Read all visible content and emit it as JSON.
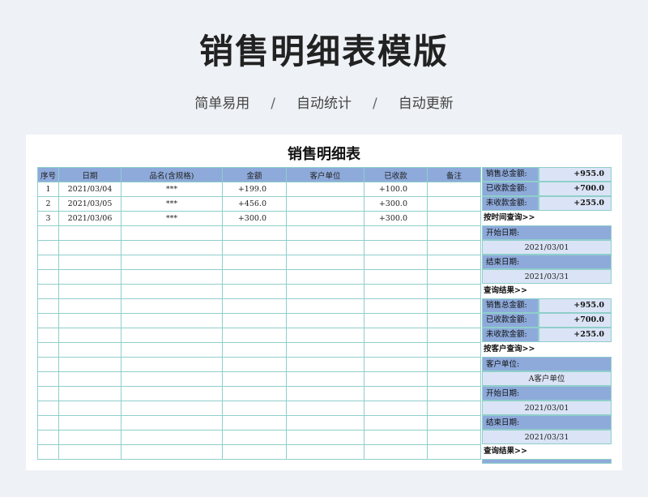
{
  "header": {
    "title": "销售明细表模版",
    "features": [
      "简单易用",
      "自动统计",
      "自动更新"
    ],
    "separator": "/"
  },
  "sheet": {
    "title": "销售明细表",
    "columns": [
      "序号",
      "日期",
      "品名(含规格)",
      "金额",
      "客户单位",
      "已收款",
      "备注"
    ],
    "rows": [
      [
        "1",
        "2021/03/04",
        "***",
        "+199.0",
        "",
        "+100.0",
        ""
      ],
      [
        "2",
        "2021/03/05",
        "***",
        "+456.0",
        "",
        "+300.0",
        ""
      ],
      [
        "3",
        "2021/03/06",
        "***",
        "+300.0",
        "",
        "+300.0",
        ""
      ]
    ],
    "empty_rows": 16
  },
  "summary": {
    "totals": [
      {
        "label": "销售总金额:",
        "value": "+955.0"
      },
      {
        "label": "已收款金额:",
        "value": "+700.0"
      },
      {
        "label": "未收款金额:",
        "value": "+255.0"
      }
    ],
    "by_time": {
      "heading": "按时间查询>>",
      "start_label": "开始日期:",
      "start_value": "2021/03/01",
      "end_label": "结束日期:",
      "end_value": "2021/03/31",
      "result_heading": "查询结果>>",
      "results": [
        {
          "label": "销售总金额:",
          "value": "+955.0"
        },
        {
          "label": "已收款金额:",
          "value": "+700.0"
        },
        {
          "label": "未收款金额:",
          "value": "+255.0"
        }
      ]
    },
    "by_customer": {
      "heading": "按客户查询>>",
      "customer_label": "客户单位:",
      "customer_value": "A客户单位",
      "start_label": "开始日期:",
      "start_value": "2021/03/01",
      "end_label": "结束日期:",
      "end_value": "2021/03/31",
      "result_heading": "查询结果>>"
    }
  }
}
